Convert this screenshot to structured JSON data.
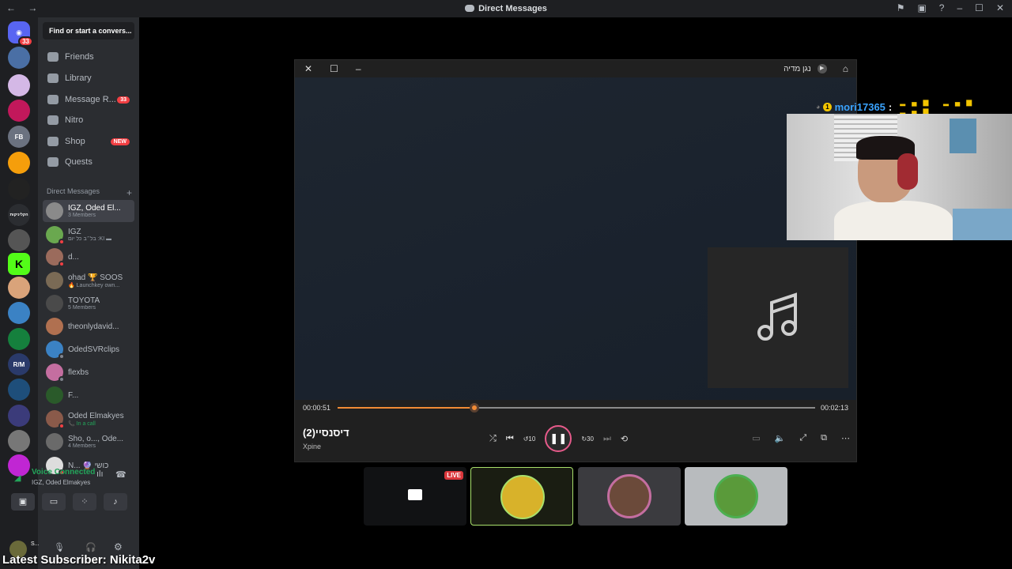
{
  "window": {
    "title": "Direct Messages",
    "nav": "← →"
  },
  "servers": {
    "discord_badge": "33",
    "items": [
      "home",
      "s1",
      "s2",
      "s3",
      "s4",
      "s5",
      "s6",
      "s7",
      "s8",
      "s9",
      "s10",
      "s11",
      "s12",
      "s13",
      "s14",
      "s15",
      "s16",
      "s17"
    ],
    "text_labels": {
      "fb": "FB",
      "hebrew": "הקליניקות",
      "k": "K",
      "rm": "R/M"
    }
  },
  "sidebar": {
    "search_placeholder": "Find or start a convers...",
    "menu": [
      {
        "label": "Friends"
      },
      {
        "label": "Library"
      },
      {
        "label": "Message R...",
        "badge": "33"
      },
      {
        "label": "Nitro"
      },
      {
        "label": "Shop",
        "badge": "NEW"
      },
      {
        "label": "Quests"
      }
    ],
    "dm_header": "Direct Messages",
    "dm_add": "+",
    "dms": [
      {
        "name": "IGZ, Oded El...",
        "sub": "3 Members",
        "color": "#8a8a8a"
      },
      {
        "name": "IGZ",
        "sub": "בל״ב כל יום :KI ▬",
        "color": "#6aa84f"
      },
      {
        "name": "d...",
        "sub": "",
        "color": "#9b6b5c"
      },
      {
        "name": "ohad 🏆 SOOS",
        "sub": "🔥 Launchkey own...",
        "color": "#7a6a55"
      },
      {
        "name": "TOYOTA",
        "sub": "5 Members",
        "color": "#4a4a4a"
      },
      {
        "name": "theonlydavid...",
        "sub": "",
        "color": "#b07050"
      },
      {
        "name": "OdedSVRclips",
        "sub": "",
        "color": "#3b82c4"
      },
      {
        "name": "flexbs",
        "sub": "",
        "color": "#c46ea0"
      },
      {
        "name": "F...",
        "sub": "",
        "color": "#2a5a2a"
      },
      {
        "name": "Oded Elmakyes",
        "sub": "📞 In a call",
        "color": "#8a5a4a"
      },
      {
        "name": "Sho, o..., Ode...",
        "sub": "4 Members",
        "color": "#6a6a6a"
      },
      {
        "name": "N... 🔮 כושי",
        "sub": "",
        "color": "#ddd"
      }
    ]
  },
  "voice": {
    "status": "Voice Connected",
    "channel": "IGZ, Oded Elmakyes"
  },
  "user": {
    "name": "S..."
  },
  "player": {
    "app_title": "נגן מדיה",
    "time_current": "00:00:51",
    "time_total": "00:02:13",
    "progress": 0.286,
    "song_title": "דיסנסיי(2)",
    "artist": "Xpine",
    "skip_back": "10",
    "skip_fwd": "30"
  },
  "overlay": {
    "chatter": "mori17365",
    "colon": ":",
    "coin": "1"
  },
  "tiles": {
    "live_label": "LIVE"
  },
  "stream": {
    "subscriber": "Latest Subscriber: Nikita2v"
  },
  "colors": {
    "accent_orange": "#f28b35",
    "discord_blurple": "#5865f2",
    "mention_red": "#f23f43",
    "online_green": "#23a55a"
  }
}
